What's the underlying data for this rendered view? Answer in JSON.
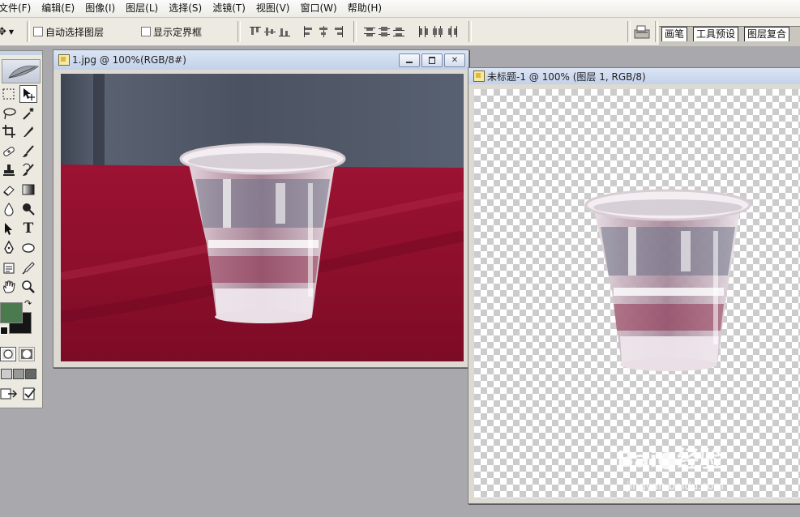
{
  "menubar": {
    "items": [
      "文件(F)",
      "编辑(E)",
      "图像(I)",
      "图层(L)",
      "选择(S)",
      "滤镜(T)",
      "视图(V)",
      "窗口(W)",
      "帮助(H)"
    ]
  },
  "options": {
    "auto_select_label": "自动选择图层",
    "auto_select_checked": false,
    "show_bounds_label": "显示定界框",
    "show_bounds_checked": false
  },
  "palette_tabs": [
    "画笔",
    "工具预设",
    "图层复合"
  ],
  "toolbox": {
    "foreground_color": "#4a7a4e",
    "background_color": "#151515"
  },
  "windows": {
    "photo": {
      "title": "1.jpg @ 100%(RGB/8#)"
    },
    "untitled": {
      "title": "未标题-1 @ 100% (图层 1, RGB/8)"
    }
  },
  "watermark": {
    "logo": "Bai●经验",
    "url": "jingyan.baidu.com"
  }
}
